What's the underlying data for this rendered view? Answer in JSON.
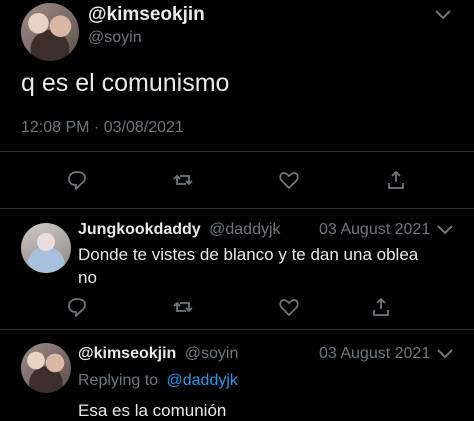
{
  "tweet": {
    "display_name": "@kimseokjin",
    "handle": "@soyin",
    "text": "q es el comunismo",
    "timestamp": "12:08 PM · 03/08/2021"
  },
  "replies": [
    {
      "display_name": "Jungkookdaddy",
      "handle": "@daddyjk",
      "date": "03 August 2021",
      "text_line1": "Donde te vistes de blanco y te dan una oblea",
      "text_line2": "no"
    },
    {
      "display_name": "@kimseokjin",
      "handle": "@soyin",
      "date": "03 August 2021",
      "replying_prefix": "Replying to",
      "replying_to": "@daddyjk",
      "text": "Esa es la comunión"
    }
  ],
  "icons": {
    "menu": "chevron-down-icon",
    "reply": "reply-icon",
    "retweet": "retweet-icon",
    "like": "heart-icon",
    "share": "share-icon"
  },
  "colors": {
    "background": "#000000",
    "text": "#e9e9e9",
    "muted": "#6e767d",
    "link": "#1d9bf0",
    "divider": "#2f3336"
  }
}
